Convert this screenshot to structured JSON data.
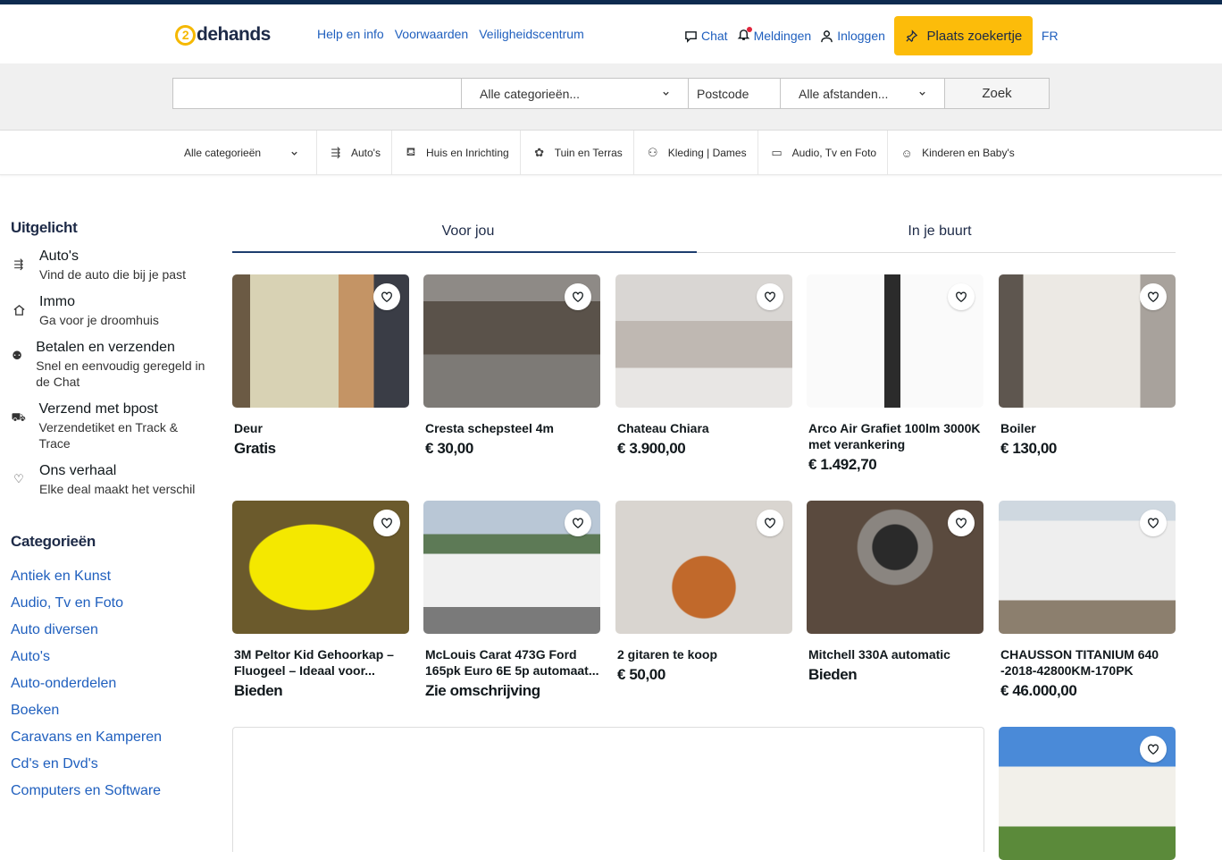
{
  "header": {
    "logo_text": "dehands",
    "logo_digit": "2",
    "links": [
      "Help en info",
      "Voorwaarden",
      "Veiligheidscentrum"
    ],
    "chat": "Chat",
    "notifications": "Meldingen",
    "login": "Inloggen",
    "place_button": "Plaats zoekertje",
    "lang": "FR"
  },
  "search": {
    "query_value": "",
    "category": "Alle categorieën...",
    "postcode_placeholder": "Postcode",
    "distance": "Alle afstanden...",
    "button": "Zoek"
  },
  "catbar": {
    "first": "Alle categorieën",
    "items": [
      "Auto's",
      "Huis en Inrichting",
      "Tuin en Terras",
      "Kleding | Dames",
      "Audio, Tv en Foto",
      "Kinderen en Baby's"
    ]
  },
  "sidebar": {
    "featured_title": "Uitgelicht",
    "featured": [
      {
        "title": "Auto's",
        "sub": "Vind de auto die bij je past"
      },
      {
        "title": "Immo",
        "sub": "Ga voor je droomhuis"
      },
      {
        "title": "Betalen en verzenden",
        "sub": "Snel en eenvoudig geregeld in de Chat"
      },
      {
        "title": "Verzend met bpost",
        "sub": "Verzendetiket en Track & Trace"
      },
      {
        "title": "Ons verhaal",
        "sub": "Elke deal maakt het verschil"
      }
    ],
    "categories_title": "Categorieën",
    "categories": [
      "Antiek en Kunst",
      "Audio, Tv en Foto",
      "Auto diversen",
      "Auto's",
      "Auto-onderdelen",
      "Boeken",
      "Caravans en Kamperen",
      "Cd's en Dvd's",
      "Computers en Software"
    ]
  },
  "tabs": [
    "Voor jou",
    "In je buurt"
  ],
  "listings": [
    {
      "title": "Deur",
      "price": "Gratis"
    },
    {
      "title": "Cresta schepsteel 4m",
      "price": "€ 30,00"
    },
    {
      "title": "Chateau Chiara",
      "price": "€ 3.900,00"
    },
    {
      "title": "Arco Air Grafiet 100lm 3000K met verankering",
      "price": "€ 1.492,70"
    },
    {
      "title": "Boiler",
      "price": "€ 130,00"
    },
    {
      "title": "3M Peltor Kid Gehoorkap – Fluogeel – Ideaal voor...",
      "price": "Bieden"
    },
    {
      "title": "McLouis Carat 473G Ford 165pk Euro 6E 5p automaat...",
      "price": "Zie omschrijving"
    },
    {
      "title": "2 gitaren te koop",
      "price": "€ 50,00"
    },
    {
      "title": "Mitchell 330A automatic",
      "price": "Bieden"
    },
    {
      "title": "CHAUSSON TITANIUM 640 -2018-42800KM-170PK",
      "price": "€ 46.000,00"
    },
    {
      "title": "",
      "price": ""
    }
  ]
}
